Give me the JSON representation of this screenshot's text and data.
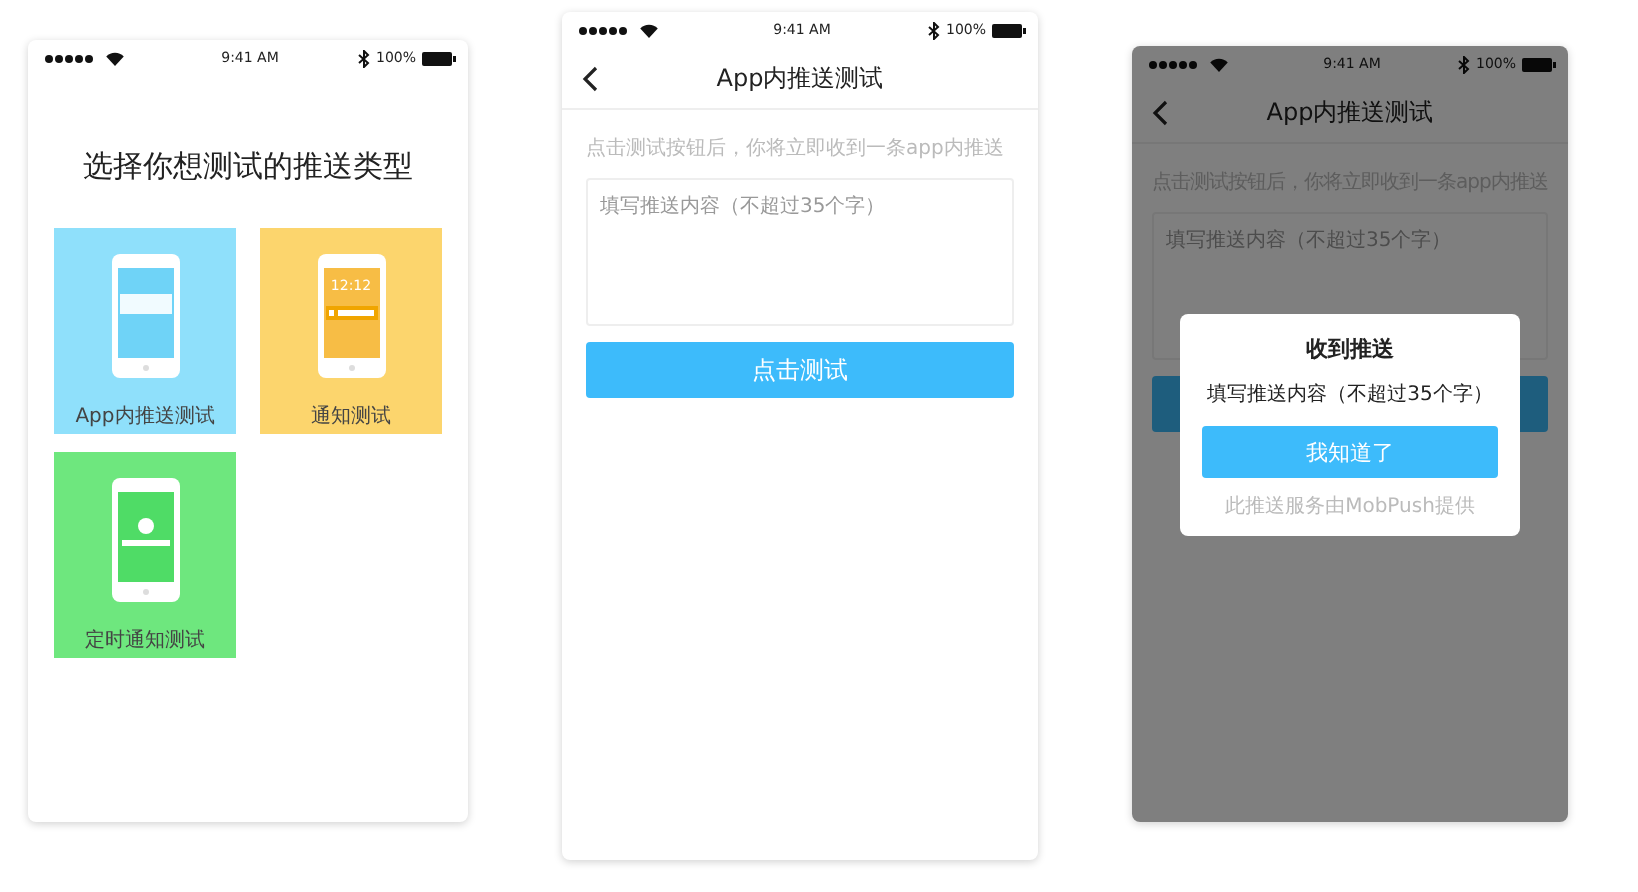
{
  "screens": [
    {
      "kind": "picker",
      "status_bar": {
        "time": "9:41 AM",
        "battery": "100%"
      },
      "title": "选择你想测试的推送类型",
      "tiles": [
        {
          "kind": "banner",
          "label": "App内推送测试",
          "color": "#8fe0fb"
        },
        {
          "kind": "lockscreen",
          "label": "通知测试",
          "color": "#fcd56d",
          "screen_time": "12:12"
        },
        {
          "kind": "timer",
          "label": "定时通知测试",
          "color": "#6ee77e"
        }
      ]
    },
    {
      "kind": "form",
      "status_bar": {
        "time": "9:41 AM",
        "battery": "100%"
      },
      "nav_title": "App内推送测试",
      "hint": "点击测试按钮后，你将立即收到一条app内推送",
      "input": {
        "placeholder": "填写推送内容（不超过35个字）"
      },
      "button": "点击测试"
    },
    {
      "kind": "form",
      "status_bar": {
        "time": "9:41 AM",
        "battery": "100%"
      },
      "nav_title": "App内推送测试",
      "hint": "点击测试按钮后，你将立即收到一条app内推送",
      "input": {
        "placeholder": "填写推送内容（不超过35个字）"
      },
      "dialog": {
        "title": "收到推送",
        "message": "填写推送内容（不超过35个字）",
        "button": "我知道了",
        "footer": "此推送服务由MobPush提供"
      }
    }
  ]
}
